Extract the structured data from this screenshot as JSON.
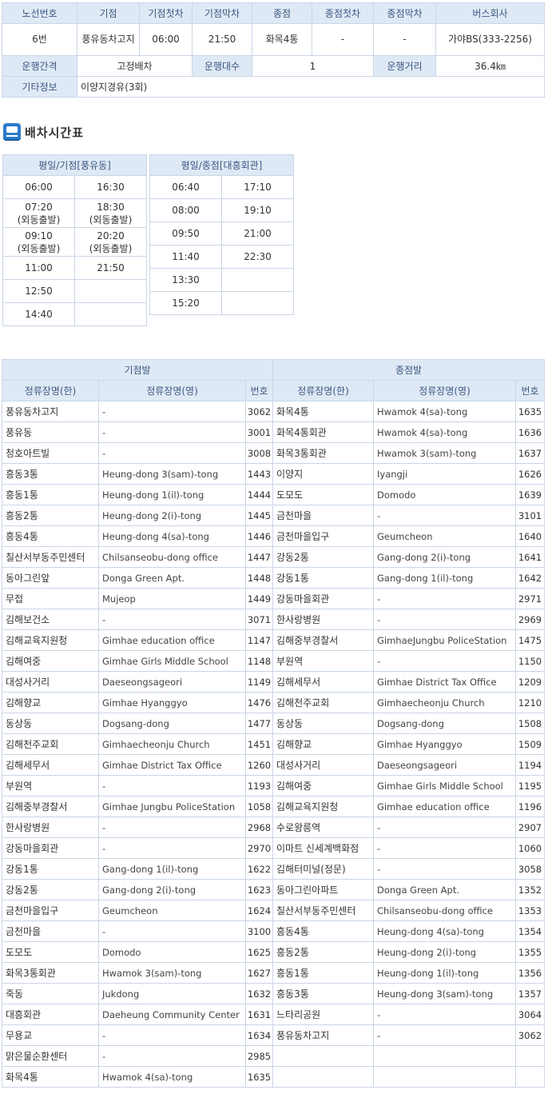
{
  "route_info": {
    "headers": [
      "노선번호",
      "기점",
      "기점첫차",
      "기점막차",
      "종점",
      "종점첫차",
      "종점막차",
      "버스회사"
    ],
    "values": [
      "6번",
      "풍유동차고지",
      "06:00",
      "21:50",
      "화목4통",
      "-",
      "-",
      "가야BS(333-2256)"
    ],
    "interval_label": "운행간격",
    "interval_value": "고정배차",
    "count_label": "운행대수",
    "count_value": "1",
    "distance_label": "운행거리",
    "distance_value": "36.4㎞",
    "etc_label": "기타정보",
    "etc_value": "이양지경유(3회)"
  },
  "schedule": {
    "heading": "배차시간표",
    "left": {
      "title": "평일/기점[풍유동]",
      "rows": [
        [
          "06:00",
          "16:30"
        ],
        [
          "07:20\n(외동출발)",
          "18:30\n(외동출발)"
        ],
        [
          "09:10\n(외동출발)",
          "20:20\n(외동출발)"
        ],
        [
          "11:00",
          "21:50"
        ],
        [
          "12:50",
          ""
        ],
        [
          "14:40",
          ""
        ]
      ]
    },
    "right": {
      "title": "평일/종점[대흥회관]",
      "rows": [
        [
          "06:40",
          "17:10"
        ],
        [
          "08:00",
          "19:10"
        ],
        [
          "09:50",
          "21:00"
        ],
        [
          "11:40",
          "22:30"
        ],
        [
          "13:30",
          ""
        ],
        [
          "15:20",
          ""
        ]
      ]
    }
  },
  "stops": {
    "origin_header": "기점발",
    "dest_header": "종점발",
    "col_kr": "정류장명(한)",
    "col_en": "정류장명(영)",
    "col_num": "번호",
    "origin": [
      [
        "풍유동차고지",
        "-",
        "3062"
      ],
      [
        "풍유동",
        "-",
        "3001"
      ],
      [
        "청호아트빌",
        "-",
        "3008"
      ],
      [
        "흥동3통",
        "Heung-dong 3(sam)-tong",
        "1443"
      ],
      [
        "흥동1통",
        "Heung-dong 1(il)-tong",
        "1444"
      ],
      [
        "흥동2통",
        "Heung-dong 2(i)-tong",
        "1445"
      ],
      [
        "흥동4통",
        "Heung-dong 4(sa)-tong",
        "1446"
      ],
      [
        "칠산서부동주민센터",
        "Chilsanseobu-dong office",
        "1447"
      ],
      [
        "동아그린앞",
        "Donga Green Apt.",
        "1448"
      ],
      [
        "무접",
        "Mujeop",
        "1449"
      ],
      [
        "김해보건소",
        "-",
        "3071"
      ],
      [
        "김해교육지원청",
        "Gimhae education office",
        "1147"
      ],
      [
        "김해여중",
        "Gimhae Girls Middle School",
        "1148"
      ],
      [
        "대성사거리",
        "Daeseongsageori",
        "1149"
      ],
      [
        "김해향교",
        "Gimhae Hyanggyo",
        "1476"
      ],
      [
        "동상동",
        "Dogsang-dong",
        "1477"
      ],
      [
        "김해천주교회",
        "Gimhaecheonju Church",
        "1451"
      ],
      [
        "김해세무서",
        "Gimhae District Tax Office",
        "1260"
      ],
      [
        "부원역",
        "-",
        "1193"
      ],
      [
        "김해중부경찰서",
        "Gimhae Jungbu PoliceStation",
        "1058"
      ],
      [
        "한사랑병원",
        "-",
        "2968"
      ],
      [
        "강동마을회관",
        "-",
        "2970"
      ],
      [
        "강동1통",
        "Gang-dong 1(il)-tong",
        "1622"
      ],
      [
        "강동2통",
        "Gang-dong 2(i)-tong",
        "1623"
      ],
      [
        "금천마을입구",
        "Geumcheon",
        "1624"
      ],
      [
        "금천마을",
        "-",
        "3100"
      ],
      [
        "도모도",
        "Domodo",
        "1625"
      ],
      [
        "화목3통회관",
        "Hwamok 3(sam)-tong",
        "1627"
      ],
      [
        "죽동",
        "Jukdong",
        "1632"
      ],
      [
        "대흥회관",
        "Daeheung Community Center",
        "1631"
      ],
      [
        "무용교",
        "-",
        "1634"
      ],
      [
        "맑은물순환센터",
        "-",
        "2985"
      ],
      [
        "화목4통",
        "Hwamok 4(sa)-tong",
        "1635"
      ]
    ],
    "dest": [
      [
        "화목4통",
        "Hwamok 4(sa)-tong",
        "1635"
      ],
      [
        "화목4통회관",
        "Hwamok 4(sa)-tong",
        "1636"
      ],
      [
        "화목3통회관",
        "Hwamok 3(sam)-tong",
        "1637"
      ],
      [
        "이양지",
        "Iyangji",
        "1626"
      ],
      [
        "도모도",
        "Domodo",
        "1639"
      ],
      [
        "금천마을",
        "-",
        "3101"
      ],
      [
        "금천마을입구",
        "Geumcheon",
        "1640"
      ],
      [
        "강동2통",
        "Gang-dong 2(i)-tong",
        "1641"
      ],
      [
        "강동1통",
        "Gang-dong 1(il)-tong",
        "1642"
      ],
      [
        "강동마을회관",
        "-",
        "2971"
      ],
      [
        "한사랑병원",
        "-",
        "2969"
      ],
      [
        "김해중부경찰서",
        "GimhaeJungbu PoliceStation",
        "1475"
      ],
      [
        "부원역",
        "-",
        "1150"
      ],
      [
        "김해세무서",
        "Gimhae District Tax Office",
        "1209"
      ],
      [
        "김해천주교회",
        "Gimhaecheonju Church",
        "1210"
      ],
      [
        "동상동",
        "Dogsang-dong",
        "1508"
      ],
      [
        "김해향교",
        "Gimhae Hyanggyo",
        "1509"
      ],
      [
        "대성사거리",
        "Daeseongsageori",
        "1194"
      ],
      [
        "김해여중",
        "Gimhae Girls Middle School",
        "1195"
      ],
      [
        "김해교육지원청",
        "Gimhae education office",
        "1196"
      ],
      [
        "수로왕릉역",
        "-",
        "2907"
      ],
      [
        "이마트 신세계백화점",
        "-",
        "1060"
      ],
      [
        "김해터미널(정문)",
        "-",
        "3058"
      ],
      [
        "동아그린아파트",
        "Donga Green Apt.",
        "1352"
      ],
      [
        "칠산서부동주민센터",
        "Chilsanseobu-dong office",
        "1353"
      ],
      [
        "흥동4통",
        "Heung-dong 4(sa)-tong",
        "1354"
      ],
      [
        "흥동2통",
        "Heung-dong 2(i)-tong",
        "1355"
      ],
      [
        "흥동1통",
        "Heung-dong 1(il)-tong",
        "1356"
      ],
      [
        "흥동3통",
        "Heung-dong 3(sam)-tong",
        "1357"
      ],
      [
        "느타리공원",
        "-",
        "3064"
      ],
      [
        "풍유동차고지",
        "-",
        "3062"
      ]
    ]
  }
}
